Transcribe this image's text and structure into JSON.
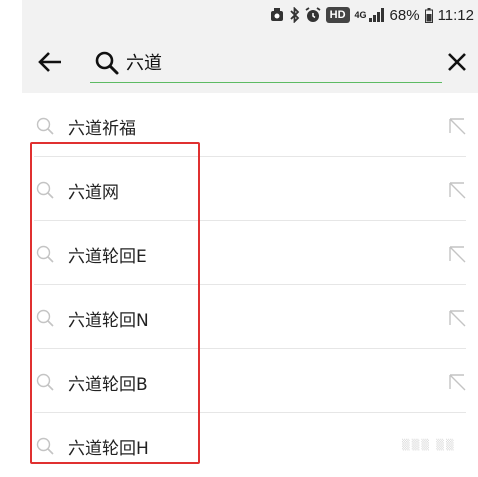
{
  "status_bar": {
    "icons": [
      "screenshot-icon",
      "bluetooth-icon",
      "alarm-icon"
    ],
    "hd_label": "HD",
    "network_label": "4G",
    "battery_percent": "68%",
    "time": "11:12"
  },
  "search": {
    "back_icon": "arrow-left-icon",
    "query": "六道",
    "clear_icon": "close-icon",
    "accent_color": "#5dbb63"
  },
  "suggestions": [
    {
      "label": "六道祈福"
    },
    {
      "label": "六道网"
    },
    {
      "label": "六道轮回E"
    },
    {
      "label": "六道轮回N"
    },
    {
      "label": "六道轮回B"
    },
    {
      "label": "六道轮回H"
    }
  ],
  "highlight": {
    "color": "#e03030",
    "covers": [
      "六道轮回E",
      "六道轮回N",
      "六道轮回B",
      "六道轮回H"
    ]
  }
}
